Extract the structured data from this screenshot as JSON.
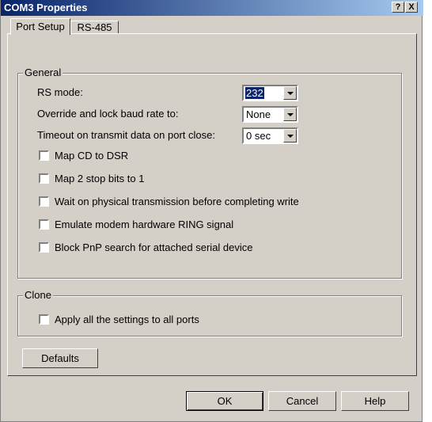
{
  "window": {
    "title": "COM3 Properties",
    "help_btn": "?",
    "close_btn": "X"
  },
  "tabs": [
    {
      "label": "Port Setup",
      "active": true
    },
    {
      "label": "RS-485",
      "active": false
    }
  ],
  "general": {
    "legend": "General",
    "rs_mode": {
      "label": "RS mode:",
      "value": "232"
    },
    "baud": {
      "label": "Override and lock baud rate to:",
      "value": "None"
    },
    "timeout": {
      "label": "Timeout on transmit data on port close:",
      "value": "0 sec"
    },
    "checkboxes": [
      {
        "label": "Map CD to DSR",
        "checked": false
      },
      {
        "label": "Map 2 stop bits to 1",
        "checked": false
      },
      {
        "label": "Wait on physical transmission before completing write",
        "checked": false
      },
      {
        "label": "Emulate modem hardware RING signal",
        "checked": false
      },
      {
        "label": "Block PnP search for attached serial device",
        "checked": false
      }
    ]
  },
  "clone": {
    "legend": "Clone",
    "checkbox": {
      "label": "Apply all the settings to all ports",
      "checked": false
    }
  },
  "buttons": {
    "defaults": "Defaults",
    "ok": "OK",
    "cancel": "Cancel",
    "help": "Help"
  }
}
